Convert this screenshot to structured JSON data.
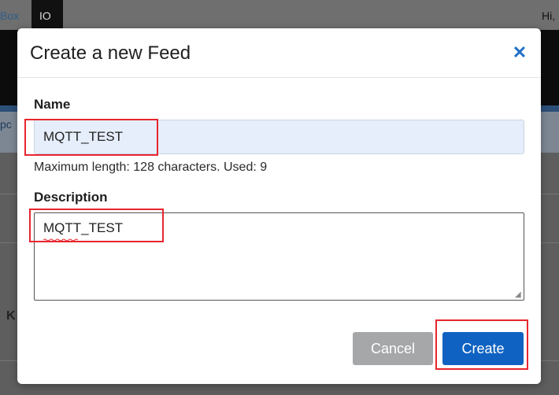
{
  "background": {
    "nav_box": "Box",
    "nav_io": "IO",
    "nav_user": "Hi,",
    "side_text": "pc",
    "side_letter": "K"
  },
  "modal": {
    "title": "Create a new Feed",
    "close_icon": "close-icon",
    "name": {
      "label": "Name",
      "value": "MQTT_TEST",
      "help": "Maximum length: 128 characters. Used: 9"
    },
    "description": {
      "label": "Description",
      "value": "MQTT_TEST"
    },
    "buttons": {
      "cancel": "Cancel",
      "create": "Create"
    }
  },
  "colors": {
    "primary": "#0f62c2",
    "close_icon": "#1f6fc7",
    "cancel": "#a5a7a8",
    "name_field_bg": "#e6eefb",
    "highlight": "#e8252e"
  }
}
